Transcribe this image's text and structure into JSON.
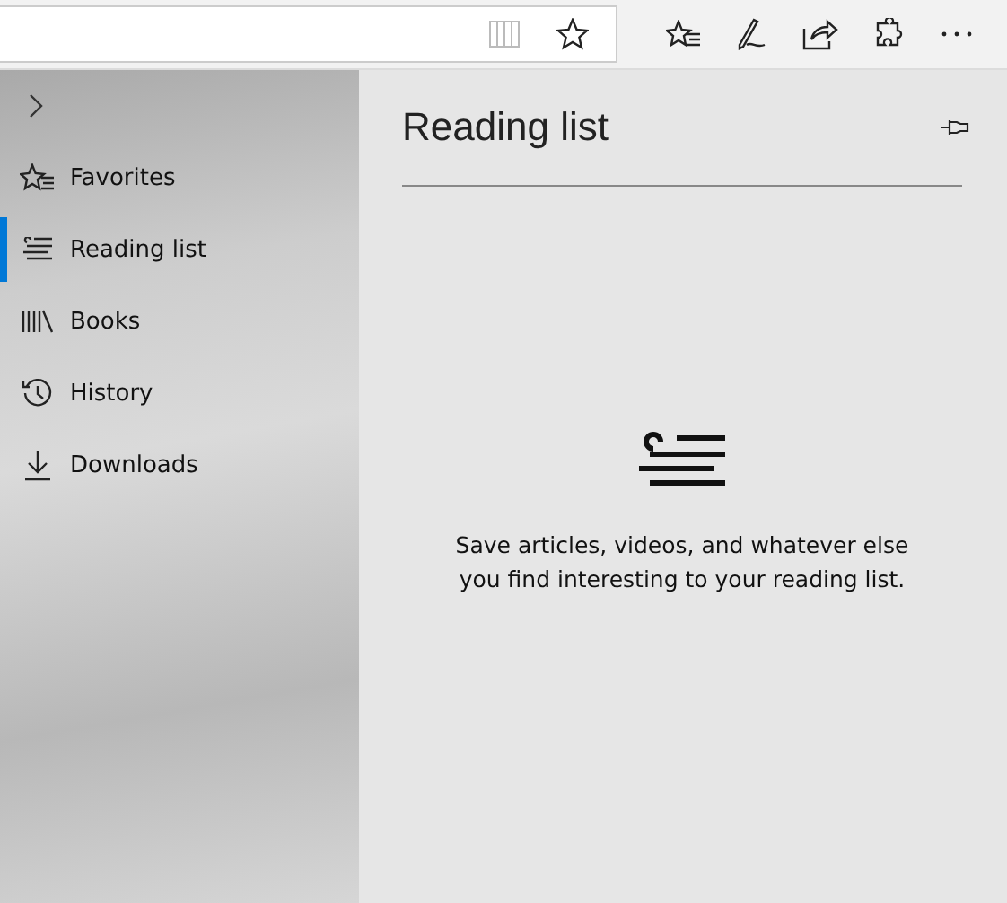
{
  "sidebar": {
    "items": [
      {
        "label": "Favorites",
        "selected": false
      },
      {
        "label": "Reading list",
        "selected": true
      },
      {
        "label": "Books",
        "selected": false
      },
      {
        "label": "History",
        "selected": false
      },
      {
        "label": "Downloads",
        "selected": false
      }
    ]
  },
  "panel": {
    "title": "Reading list",
    "empty_message": "Save articles, videos, and whatever else you find interesting to your reading list."
  }
}
